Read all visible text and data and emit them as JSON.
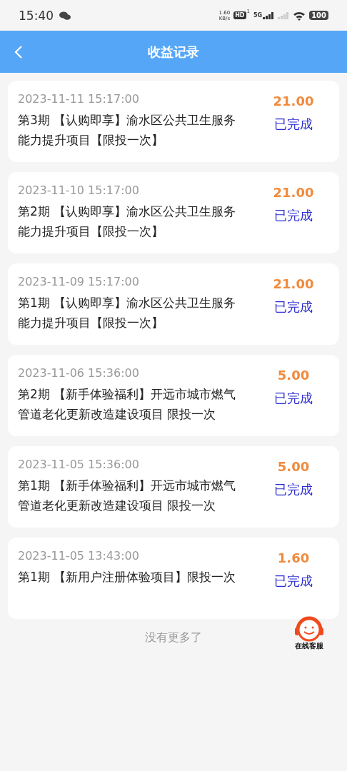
{
  "status_bar": {
    "time": "15:40",
    "speed_value": "1.60",
    "speed_unit": "KB/s",
    "hd": "HD",
    "hd_sub": "1",
    "network": "5G",
    "battery": "100"
  },
  "header": {
    "title": "收益记录"
  },
  "records": [
    {
      "date": "2023-11-11 15:17:00",
      "title": "第3期 【认购即享】渝水区公共卫生服务能力提升项目【限投一次】",
      "amount": "21.00",
      "status": "已完成"
    },
    {
      "date": "2023-11-10 15:17:00",
      "title": "第2期 【认购即享】渝水区公共卫生服务能力提升项目【限投一次】",
      "amount": "21.00",
      "status": "已完成"
    },
    {
      "date": "2023-11-09 15:17:00",
      "title": "第1期 【认购即享】渝水区公共卫生服务能力提升项目【限投一次】",
      "amount": "21.00",
      "status": "已完成"
    },
    {
      "date": "2023-11-06 15:36:00",
      "title": "第2期 【新手体验福利】开远市城市燃气管道老化更新改造建设项目 限投一次",
      "amount": "5.00",
      "status": "已完成"
    },
    {
      "date": "2023-11-05 15:36:00",
      "title": "第1期 【新手体验福利】开远市城市燃气管道老化更新改造建设项目 限投一次",
      "amount": "5.00",
      "status": "已完成"
    },
    {
      "date": "2023-11-05 13:43:00",
      "title": "第1期 【新用户注册体验项目】限投一次",
      "amount": "1.60",
      "status": "已完成"
    }
  ],
  "end_text": "没有更多了",
  "support_button": {
    "label": "在线客服"
  }
}
